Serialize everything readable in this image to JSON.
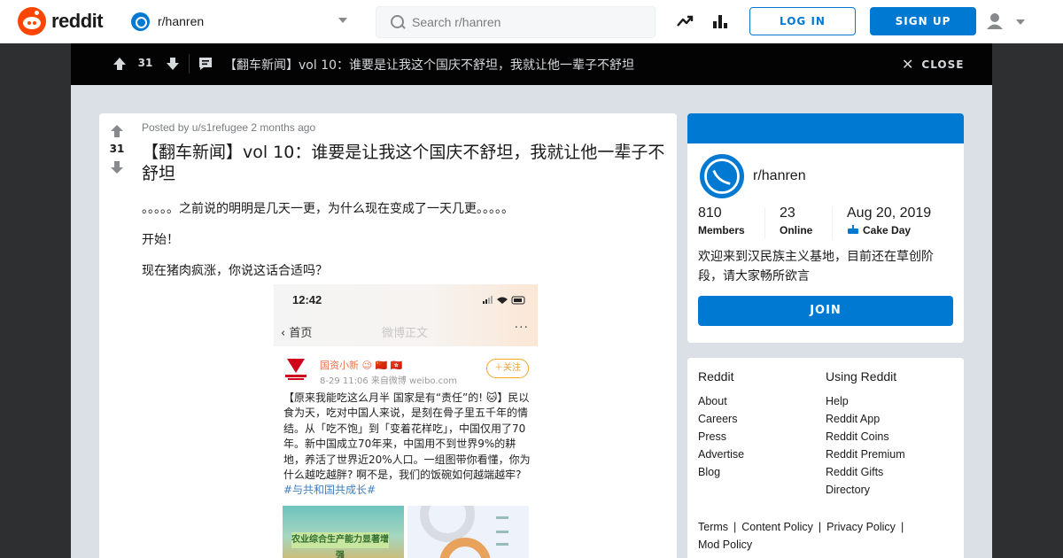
{
  "header": {
    "logo_text": "reddit",
    "subreddit": "r/hanren",
    "search_placeholder": "Search r/hanren",
    "login_label": "LOG IN",
    "signup_label": "SIGN UP"
  },
  "postbar": {
    "score": "31",
    "title": "【翻车新闻】vol 10：谁要是让我这个国庆不舒坦，我就让他一辈子不舒坦",
    "close_label": "CLOSE"
  },
  "post": {
    "meta": "Posted by u/s1refugee 2 months ago",
    "score": "31",
    "title": "【翻车新闻】vol 10：谁要是让我这个国庆不舒坦，我就让他一辈子不舒坦",
    "paragraphs": [
      "。。。。。之前说的明明是几天一更，为什么现在变成了一天几更。。。。。",
      "开始！",
      "现在猪肉疯涨，你说这话合适吗？"
    ],
    "image": {
      "time": "12:42",
      "back_label": "首页",
      "heading": "微博正文",
      "more": "···",
      "author": "国资小新 😉 🇨🇳 🇭🇰",
      "date": "8-29 11:06  来自微博 weibo.com",
      "follow": "＋关注",
      "text": "【原来我能吃这么月半 国家是有“责任”的! 🐱】民以食为天，吃对中国人来说，是刻在骨子里五千年的情结。从「吃不饱」到「变着花样吃」，中国仅用了70年。新中国成立70年来，中国用不到世界9%的耕地，养活了世界近20%人口。一组图带你看懂，你为什么越吃越胖? 啊不是，我们的饭碗如何越端越牢? ",
      "tag": "#与共和国共成长#",
      "banner_text": "农业综合生产能力显著增强"
    }
  },
  "sidebar": {
    "about": {
      "name": "r/hanren",
      "members_count": "810",
      "members_label": "Members",
      "online_count": "23",
      "online_label": "Online",
      "cake_date": "Aug 20, 2019",
      "cake_label": "Cake Day",
      "description": "欢迎来到汉民族主义基地，目前还在草创阶段，请大家畅所欲言",
      "join_label": "JOIN"
    },
    "links": {
      "col1_heading": "Reddit",
      "col1": [
        "About",
        "Careers",
        "Press",
        "Advertise",
        "Blog"
      ],
      "col2_heading": "Using Reddit",
      "col2": [
        "Help",
        "Reddit App",
        "Reddit Coins",
        "Reddit Premium",
        "Reddit Gifts",
        "Directory"
      ],
      "footer": [
        "Terms",
        "Content Policy",
        "Privacy Policy",
        "Mod Policy"
      ]
    }
  },
  "colors": {
    "brand": "#ff4500",
    "accent": "#0079d3",
    "overlay": "#030303",
    "backdrop": "#dae0e6"
  }
}
